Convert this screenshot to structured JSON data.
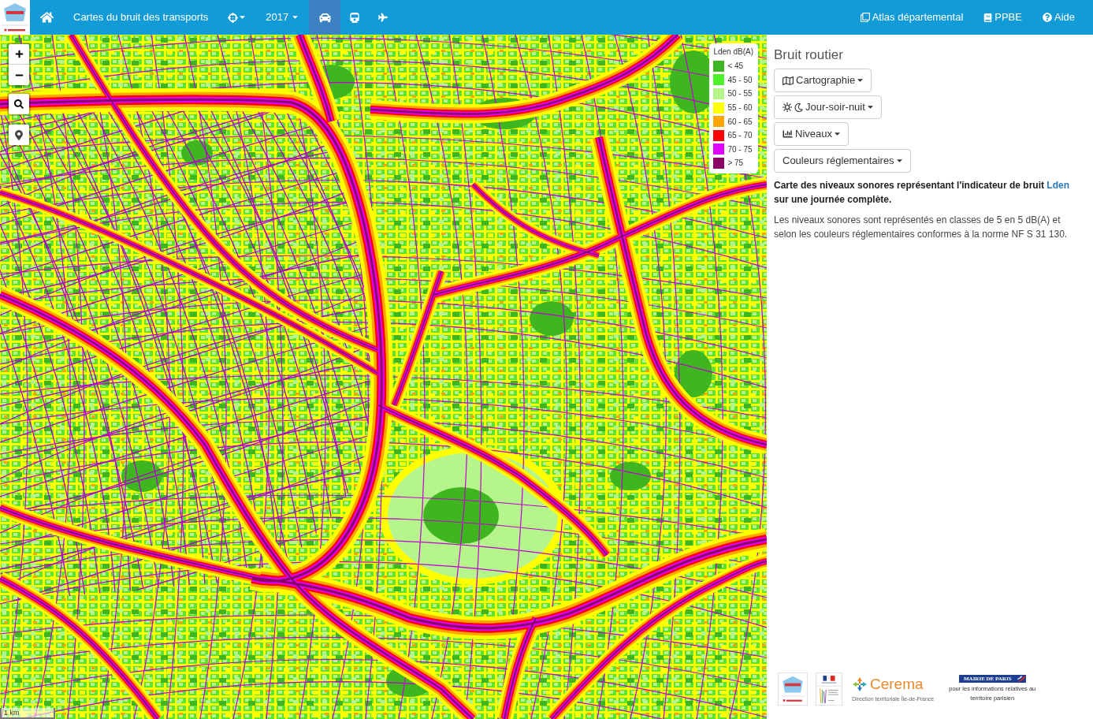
{
  "navbar": {
    "title": "Cartes du bruit des transports",
    "year_menu": {
      "label": "2017"
    },
    "transport_tabs": [
      {
        "kind": "road",
        "selected": true
      },
      {
        "kind": "rail",
        "selected": false
      },
      {
        "kind": "air",
        "selected": false
      }
    ],
    "links": [
      {
        "kind": "atlas",
        "label": "Atlas départemental"
      },
      {
        "kind": "ppbe",
        "label": "PPBE"
      },
      {
        "kind": "help",
        "label": "Aide"
      }
    ]
  },
  "map": {
    "legend": {
      "title": "Lden dB(A)",
      "classes": [
        {
          "label": "< 45",
          "color": "#3fb61f"
        },
        {
          "label": "45 - 50",
          "color": "#4ef02a"
        },
        {
          "label": "50 - 55",
          "color": "#b5f58c"
        },
        {
          "label": "55 - 60",
          "color": "#ffff00"
        },
        {
          "label": "60 - 65",
          "color": "#ffa500"
        },
        {
          "label": "65 - 70",
          "color": "#ff0000"
        },
        {
          "label": "70 - 75",
          "color": "#dd00ff"
        },
        {
          "label": "> 75",
          "color": "#8b0063"
        }
      ]
    },
    "scale": "1 km"
  },
  "panel": {
    "title": "Bruit routier",
    "dropdowns": [
      {
        "kind": "map",
        "label": "Cartographie"
      },
      {
        "kind": "daynight",
        "label": "Jour-soir-nuit"
      },
      {
        "kind": "levels",
        "label": "Niveaux"
      },
      {
        "kind": "plain",
        "label": "Couleurs réglementaires"
      }
    ],
    "description": {
      "text": "Carte des niveaux sonores représentant l'indicateur de bruit",
      "link": "Lden",
      "tail": "sur une journée complète."
    },
    "note": "Les niveaux sonores sont représentés en classes de 5 en 5 dB(A) et selon les couleurs réglementaires conformes à la norme NF S 31 130.",
    "partners": [
      {
        "kind": "pentagon"
      },
      {
        "kind": "flag"
      },
      {
        "kind": "arrows",
        "name": "Cerema",
        "caption": "Direction territoriale Île-de-France"
      },
      {
        "kind": "banner",
        "name": "MAIRIE DE PARIS",
        "caption": "pour les informations relatives au territoire parisien"
      }
    ]
  }
}
